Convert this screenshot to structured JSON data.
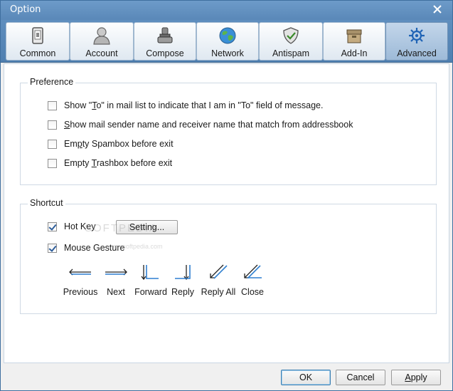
{
  "window": {
    "title": "Option"
  },
  "tabs": [
    {
      "label": "Common",
      "icon": "phone-icon"
    },
    {
      "label": "Account",
      "icon": "user-icon"
    },
    {
      "label": "Compose",
      "icon": "stamp-icon"
    },
    {
      "label": "Network",
      "icon": "globe-icon"
    },
    {
      "label": "Antispam",
      "icon": "shield-icon"
    },
    {
      "label": "Add-In",
      "icon": "box-icon"
    },
    {
      "label": "Advanced",
      "icon": "gear-icon",
      "active": true
    }
  ],
  "preference": {
    "legend": "Preference",
    "options": [
      {
        "pre": "Show \"",
        "acc": "T",
        "post": "o\" in mail list to indicate that I am in \"To\" field of message.",
        "checked": false
      },
      {
        "pre": "",
        "acc": "S",
        "post": "how mail sender name and receiver name that  match from addressbook",
        "checked": false
      },
      {
        "pre": "Em",
        "acc": "p",
        "post": "ty Spambox before exit",
        "checked": false
      },
      {
        "pre": "Empty ",
        "acc": "T",
        "post": "rashbox before exit",
        "checked": false
      }
    ]
  },
  "shortcut": {
    "legend": "Shortcut",
    "hotkey_label": "Hot Key",
    "hotkey_checked": true,
    "setting_label": "Setting...",
    "mouse_gesture_label": "Mouse Gesture",
    "mouse_gesture_checked": true,
    "gestures": [
      {
        "label": "Previous",
        "icon": "arrow-left-icon"
      },
      {
        "label": "Next",
        "icon": "arrow-right-icon"
      },
      {
        "label": "Forward",
        "icon": "down-right-gesture-icon"
      },
      {
        "label": "Reply",
        "icon": "down-left-gesture-icon"
      },
      {
        "label": "Reply All",
        "icon": "diagonal-double-icon"
      },
      {
        "label": "Close",
        "icon": "diagonal-corner-icon"
      }
    ]
  },
  "watermark": {
    "main": "SOFTPEDIA",
    "sub": "www.softpedia.com"
  },
  "footer": {
    "ok": "OK",
    "cancel": "Cancel",
    "apply_acc": "A",
    "apply_post": "pply"
  },
  "colors": {
    "title_bar": "#6d9bc9",
    "toolbar": "#5f8ebe",
    "active_tab": "#9dbad8",
    "gesture_blue": "#2f7fd0"
  }
}
